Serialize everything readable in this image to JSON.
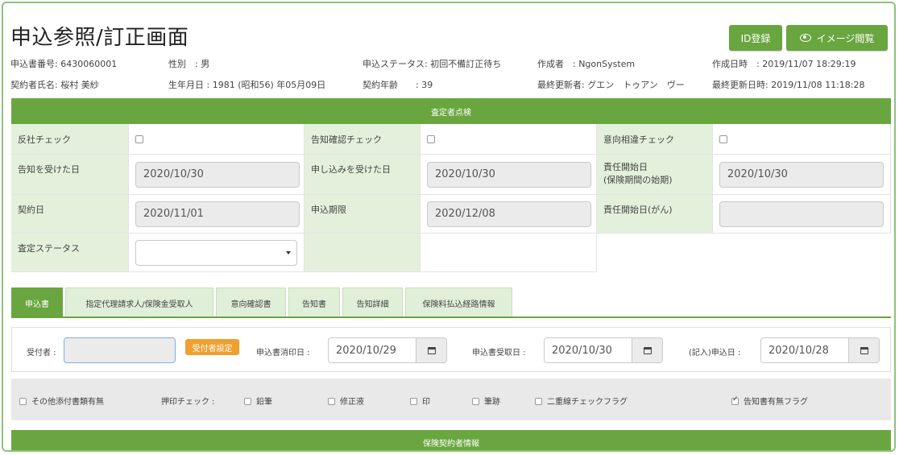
{
  "title": "申込参照/訂正画面",
  "buttons": {
    "id_register": "ID登録",
    "image_view": "イメージ閲覧"
  },
  "info": {
    "app_no": "申込書番号: 6430060001",
    "gender": "性別　: 男",
    "app_status": "申込ステータス: 初回不備訂正待ち",
    "creator": "作成者　: NgonSystem",
    "created_at": "作成日時　: 2019/11/07 18:29:19",
    "contractor": "契約者氏名: 桜村 美紗",
    "birthdate": "生年月日 : 1981 (昭和56) 年05月09日",
    "contract_age": "契約年齢　　: 39",
    "updater": "最終更新者: グエン　トゥアン　ヴー",
    "updated_at": "最終更新日時: 2019/11/08 11:18:28"
  },
  "assessor_section": "査定者点検",
  "grid": {
    "antisocial_check": "反社チェック",
    "notice_confirm_check": "告知確認チェック",
    "intent_mismatch_check": "意向相違チェック",
    "notice_received_date_label": "告知を受けた日",
    "notice_received_date": "2020/10/30",
    "application_received_date_label": "申し込みを受けた日",
    "application_received_date": "2020/10/30",
    "liability_start_label": "責任開始日\n(保険期間の始期)",
    "liability_start_date": "2020/10/30",
    "contract_date_label": "契約日",
    "contract_date": "2020/11/01",
    "application_deadline_label": "申込期限",
    "application_deadline": "2020/12/08",
    "liability_start_cancer_label": "責任開始日(がん)",
    "liability_start_cancer": "",
    "assessment_status_label": "査定ステータス"
  },
  "tabs": [
    "申込書",
    "指定代理請求人/保険金受取人",
    "意向確認書",
    "告知書",
    "告知詳細",
    "保険料払込経路情報"
  ],
  "form": {
    "receiver_label": "受付者 :",
    "receiver_value": "",
    "receiver_button": "受付者設定",
    "stamp_date_label": "申込書消印日 :",
    "stamp_date": "2020/10/29",
    "received_date_label": "申込書受取日 :",
    "received_date": "2020/10/30",
    "filled_date_label": "(記入)申込日 :",
    "filled_date": "2020/10/28"
  },
  "checks": {
    "other_docs": "その他添付書類有無",
    "seal_check_label": "押印チェック :",
    "pencil": "鉛筆",
    "correction_fluid": "修正液",
    "seal": "印",
    "signature": "筆跡",
    "double_line": "二重線チェックフラグ",
    "notice_doc": "告知書有無フラグ"
  },
  "footer_section": "保険契約者情報",
  "colors": {
    "accent": "#6aa63f",
    "label_bg": "#e3f1dc"
  }
}
